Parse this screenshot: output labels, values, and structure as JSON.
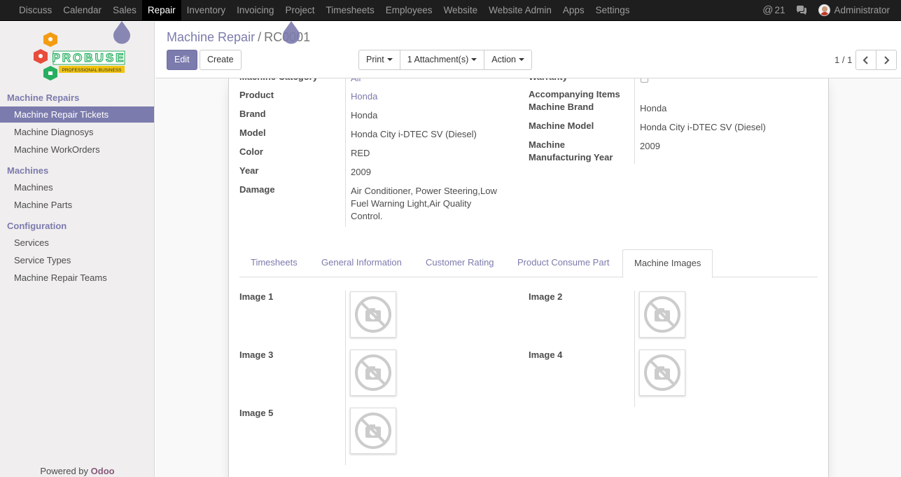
{
  "topbar": {
    "menu": [
      "Discuss",
      "Calendar",
      "Sales",
      "Repair",
      "Inventory",
      "Invoicing",
      "Project",
      "Timesheets",
      "Employees",
      "Website",
      "Website Admin",
      "Apps",
      "Settings"
    ],
    "active": "Repair",
    "mentions_count": "21",
    "user": "Administrator"
  },
  "sidebar": {
    "logo_text": "PROBUSE",
    "logo_subtext": "PROFESSIONAL BUSINESS",
    "sections": [
      {
        "title": "Machine Repairs",
        "items": [
          "Machine Repair Tickets",
          "Machine Diagnosys",
          "Machine WorkOrders"
        ]
      },
      {
        "title": "Machines",
        "items": [
          "Machines",
          "Machine Parts"
        ]
      },
      {
        "title": "Configuration",
        "items": [
          "Services",
          "Service Types",
          "Machine Repair Teams"
        ]
      }
    ],
    "powered_by": "Powered by",
    "powered_brand": "Odoo"
  },
  "control": {
    "breadcrumb_parent": "Machine Repair",
    "breadcrumb_sep": "/",
    "breadcrumb_current": "RC0001",
    "edit_label": "Edit",
    "create_label": "Create",
    "print_label": "Print",
    "attachments_label": "1 Attachment(s)",
    "action_label": "Action",
    "pager": "1 / 1"
  },
  "form": {
    "left": {
      "category_label": "Machine Category",
      "category_value": "All",
      "product_label": "Product",
      "product_value": "Honda",
      "brand_label": "Brand",
      "brand_value": "Honda",
      "model_label": "Model",
      "model_value": "Honda City i-DTEC SV (Diesel)",
      "color_label": "Color",
      "color_value": "RED",
      "year_label": "Year",
      "year_value": "2009",
      "damage_label": "Damage",
      "damage_value_1": "Air Conditioner, Power Steering,Low",
      "damage_value_2": "Fuel Warning Light,Air Quality",
      "damage_value_3": "Control."
    },
    "right": {
      "warranty_label": "Warranty",
      "accompanying_label": "Accompanying Items",
      "machine_brand_label": "Machine Brand",
      "machine_brand_value": "Honda",
      "machine_model_label": "Machine Model",
      "machine_model_value": "Honda City i-DTEC SV (Diesel)",
      "mfg_year_label_1": "Machine",
      "mfg_year_label_2": "Manufacturing Year",
      "mfg_year_value": "2009"
    },
    "tabs": [
      "Timesheets",
      "General Information",
      "Customer Rating",
      "Product Consume Part",
      "Machine Images"
    ],
    "active_tab": "Machine Images",
    "images": [
      "Image 1",
      "Image 2",
      "Image 3",
      "Image 4",
      "Image 5"
    ]
  },
  "colors": {
    "accent": "#7c7bad",
    "navbar": "#1e1e1e",
    "brand_odoo": "#875a7b"
  }
}
